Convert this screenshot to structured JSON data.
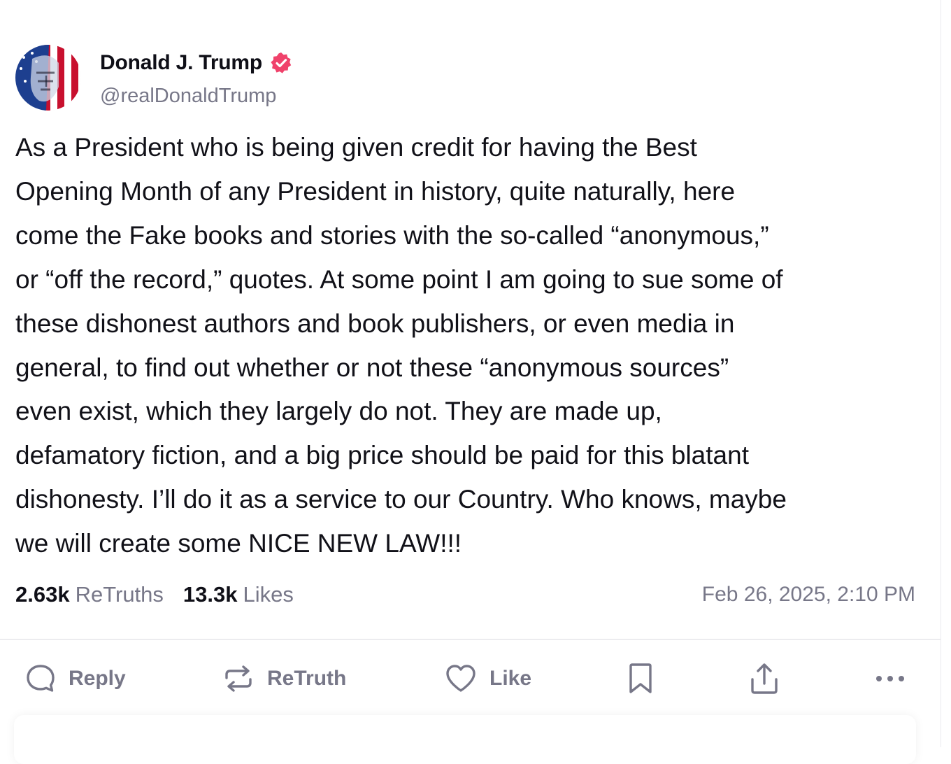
{
  "post": {
    "display_name": "Donald J. Trump",
    "handle": "@realDonaldTrump",
    "body_lines": [
      "As a President who is being given credit for having the Best",
      "Opening Month of any President in history, quite naturally, here",
      "come the Fake books and stories with the so-called “anonymous,”",
      "or “off the record,” quotes. At some point I am going to sue some of",
      "these dishonest authors and book publishers, or even media in",
      "general, to find out whether or not these “anonymous sources”",
      "even exist, which they largely do not. They are made up,",
      "defamatory fiction, and a big price should be paid for this blatant",
      "dishonesty. I’ll do it as a service to our Country. Who knows, maybe",
      "we will create some NICE NEW LAW!!!"
    ],
    "retruths_count": "2.63k",
    "retruths_label": "ReTruths",
    "likes_count": "13.3k",
    "likes_label": "Likes",
    "timestamp": "Feb 26, 2025, 2:10 PM"
  },
  "actions": {
    "reply_label": "Reply",
    "retruth_label": "ReTruth",
    "like_label": "Like"
  },
  "icons": {
    "verified": "verified-badge-icon",
    "reply": "reply-icon",
    "retruth": "retruth-icon",
    "like": "heart-icon",
    "bookmark": "bookmark-icon",
    "share": "share-icon",
    "more": "more-icon"
  },
  "colors": {
    "verified_badge": "#f0426b",
    "text_primary": "#0f0f17",
    "text_secondary": "#777788"
  }
}
